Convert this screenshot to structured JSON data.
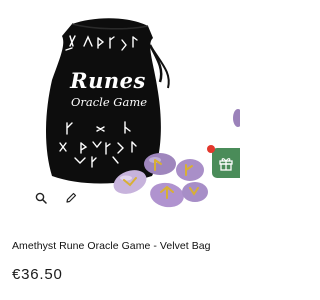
{
  "product": {
    "title": "Amethyst Rune Oracle Game - Velvet Bag",
    "price": "€36.50"
  },
  "image": {
    "bag_title": "Runes",
    "bag_subtitle": "Oracle Game"
  },
  "icons": {
    "zoom": "magnifier-icon",
    "edit": "pencil-icon",
    "gift": "gift-icon"
  },
  "colors": {
    "gift_button": "#4a8c59",
    "notification_dot": "#e3372c",
    "bag": "#0d0d0d",
    "amethyst": "#b89ad0"
  }
}
